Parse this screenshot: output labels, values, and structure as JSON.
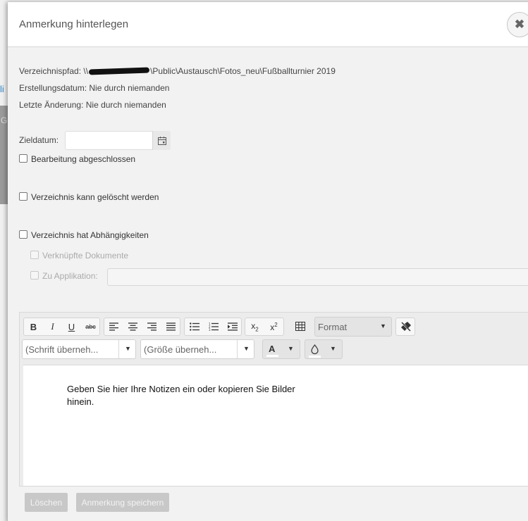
{
  "background": {
    "link_fragment": "li",
    "side_letter": "G"
  },
  "modal": {
    "title": "Anmerkung hinterlegen",
    "close_icon": "close-icon"
  },
  "info": {
    "path_label": "Verzeichnispfad: \\\\",
    "path_value": "\\Public\\Austausch\\Fotos_neu\\Fußballturnier 2019",
    "created": "Erstellungsdatum: Nie durch niemanden",
    "changed": "Letzte Änderung: Nie durch niemanden"
  },
  "form": {
    "target_date_label": "Zieldatum:",
    "target_date_value": "",
    "checkbox_done": "Bearbeitung abgeschlossen",
    "checkbox_deletable": "Verzeichnis kann gelöscht werden",
    "checkbox_dependencies": "Verzeichnis hat Abhängigkeiten",
    "checkbox_linked_docs": "Verknüpfte Dokumente",
    "checkbox_application": "Zu Applikation:",
    "application_value": ""
  },
  "editor": {
    "toolbar": {
      "bold": "B",
      "italic": "I",
      "underline": "U",
      "strike": "abc",
      "format_label": "Format",
      "font_label": "(Schrift überneh...",
      "size_label": "(Größe überneh...",
      "font_color_label": "A"
    },
    "placeholder": "Geben Sie hier Ihre Notizen ein oder kopieren Sie Bilder hinein."
  },
  "footer": {
    "delete_label": "Löschen",
    "save_label": "Anmerkung speichern"
  }
}
